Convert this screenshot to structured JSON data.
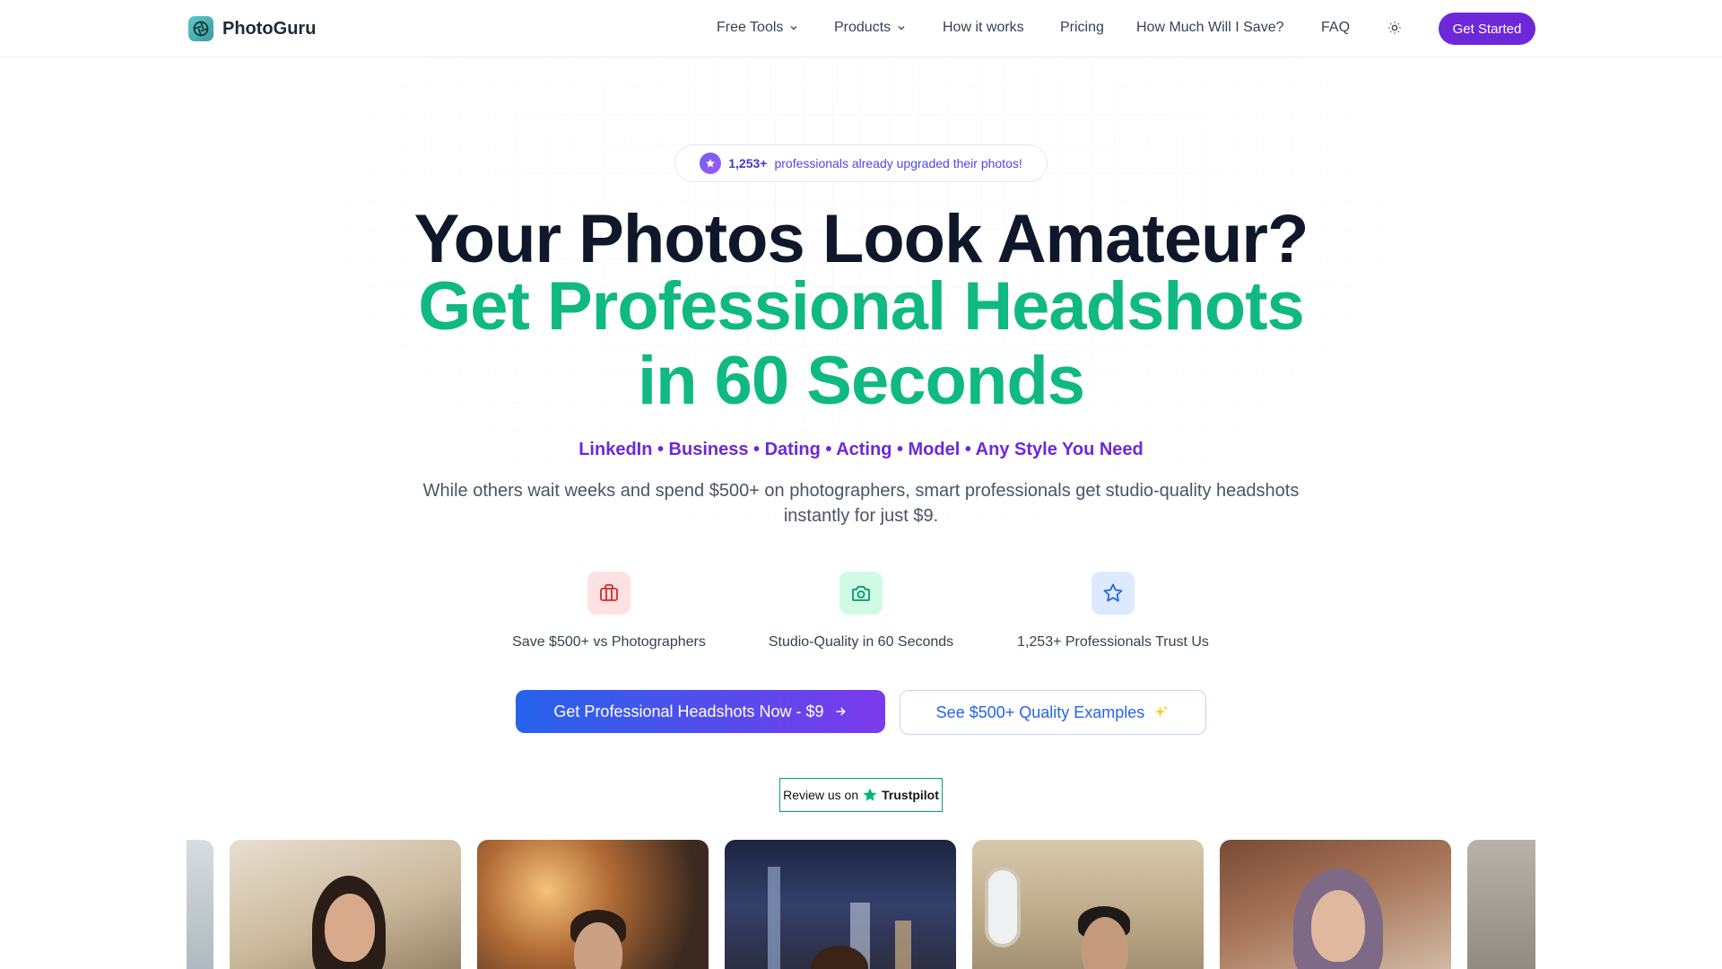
{
  "brand": {
    "name": "PhotoGuru"
  },
  "nav": {
    "items": [
      {
        "label": "Free Tools",
        "dropdown": true
      },
      {
        "label": "Products",
        "dropdown": true
      },
      {
        "label": "How it works",
        "dropdown": false
      },
      {
        "label": "Pricing",
        "dropdown": false
      },
      {
        "label": "How Much Will I Save?",
        "dropdown": false
      },
      {
        "label": "FAQ",
        "dropdown": false
      }
    ],
    "theme_icon": "sun-icon",
    "cta_label": "Get Started"
  },
  "hero": {
    "badge_count": "1,253+",
    "badge_text": "professionals already upgraded their photos!",
    "headline_line1": "Your Photos Look Amateur?",
    "headline_line2": "Get Professional Headshots",
    "headline_line3": "in 60 Seconds",
    "tags": "LinkedIn • Business • Dating • Acting • Model • Any Style You Need",
    "subtitle": "While others wait weeks and spend $500+ on photographers, smart professionals get studio-quality headshots instantly for just $9.",
    "features": [
      {
        "icon": "briefcase-icon",
        "label": "Save $500+ vs Photographers"
      },
      {
        "icon": "camera-icon",
        "label": "Studio-Quality in 60 Seconds"
      },
      {
        "icon": "star-icon",
        "label": "1,253+ Professionals Trust Us"
      }
    ],
    "primary_cta": "Get Professional Headshots Now - $9",
    "secondary_cta": "See $500+ Quality Examples",
    "trustpilot_prefix": "Review us on",
    "trustpilot_brand": "Trustpilot"
  },
  "colors": {
    "brand_purple": "#6d28d9",
    "headline_green": "#10b981",
    "headline_dark": "#0f172a",
    "link_blue": "#2563eb",
    "trustpilot_green": "#00b67a"
  }
}
